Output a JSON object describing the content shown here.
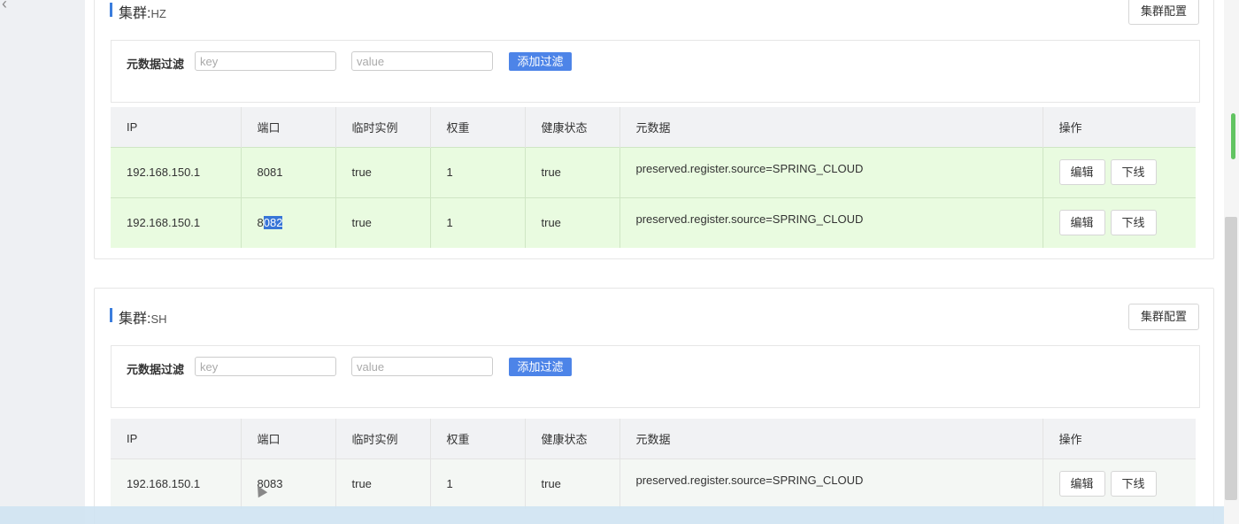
{
  "clusters": [
    {
      "title_label": "集群:",
      "name": "HZ",
      "config_label": "集群配置",
      "filter": {
        "label": "元数据过滤",
        "key_placeholder": "key",
        "value_placeholder": "value",
        "add_label": "添加过滤"
      },
      "columns": [
        "IP",
        "端口",
        "临时实例",
        "权重",
        "健康状态",
        "元数据",
        "操作"
      ],
      "rows": [
        {
          "ip": "192.168.150.1",
          "port": "8081",
          "ephemeral": "true",
          "weight": "1",
          "healthy": "true",
          "metadata": "preserved.register.source=SPRING_CLOUD",
          "edit": "编辑",
          "offline": "下线"
        },
        {
          "ip": "192.168.150.1",
          "port_head": "8",
          "port_selected": "082",
          "ephemeral": "true",
          "weight": "1",
          "healthy": "true",
          "metadata": "preserved.register.source=SPRING_CLOUD",
          "edit": "编辑",
          "offline": "下线"
        }
      ]
    },
    {
      "title_label": "集群:",
      "name": "SH",
      "config_label": "集群配置",
      "filter": {
        "label": "元数据过滤",
        "key_placeholder": "key",
        "value_placeholder": "value",
        "add_label": "添加过滤"
      },
      "columns": [
        "IP",
        "端口",
        "临时实例",
        "权重",
        "健康状态",
        "元数据",
        "操作"
      ],
      "rows": [
        {
          "ip": "192.168.150.1",
          "port": "8083",
          "ephemeral": "true",
          "weight": "1",
          "healthy": "true",
          "metadata": "preserved.register.source=SPRING_CLOUD",
          "edit": "编辑",
          "offline": "下线"
        }
      ]
    }
  ],
  "colors": {
    "accent": "#3b7ddd",
    "add_button": "#4d84e8",
    "row_green": "#e9fbe0",
    "header_bg": "#f1f2f4",
    "selection": "#3875d7"
  },
  "icons": {
    "back": "chevron-left-icon",
    "cursor": "mouse-cursor-icon"
  }
}
